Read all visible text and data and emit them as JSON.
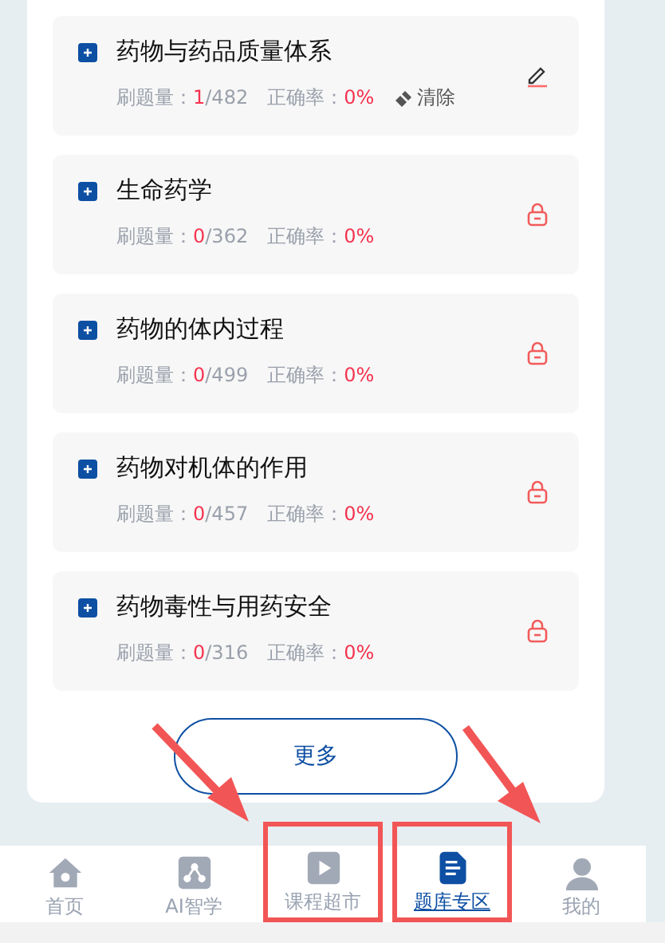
{
  "chapters": [
    {
      "title": "药物与药品质量体系",
      "count_label": "刷题量：",
      "done": "1",
      "total": "/482",
      "rate_label": "正确率：",
      "rate": "0%",
      "kind": "edit",
      "clear": "清除"
    },
    {
      "title": "生命药学",
      "count_label": "刷题量：",
      "done": "0",
      "total": "/362",
      "rate_label": "正确率：",
      "rate": "0%",
      "kind": "locked"
    },
    {
      "title": "药物的体内过程",
      "count_label": "刷题量：",
      "done": "0",
      "total": "/499",
      "rate_label": "正确率：",
      "rate": "0%",
      "kind": "locked"
    },
    {
      "title": "药物对机体的作用",
      "count_label": "刷题量：",
      "done": "0",
      "total": "/457",
      "rate_label": "正确率：",
      "rate": "0%",
      "kind": "locked"
    },
    {
      "title": "药物毒性与用药安全",
      "count_label": "刷题量：",
      "done": "0",
      "total": "/316",
      "rate_label": "正确率：",
      "rate": "0%",
      "kind": "locked"
    }
  ],
  "more_button": "更多",
  "tabs": [
    {
      "label": "首页",
      "kind": "home",
      "selected": false,
      "highlighted": false
    },
    {
      "label": "AI智学",
      "kind": "ai",
      "selected": false,
      "highlighted": false
    },
    {
      "label": "课程超市",
      "kind": "video",
      "selected": false,
      "highlighted": true
    },
    {
      "label": "题库专区",
      "kind": "bank",
      "selected": true,
      "highlighted": true
    },
    {
      "label": "我的",
      "kind": "me",
      "selected": false,
      "highlighted": false
    }
  ]
}
